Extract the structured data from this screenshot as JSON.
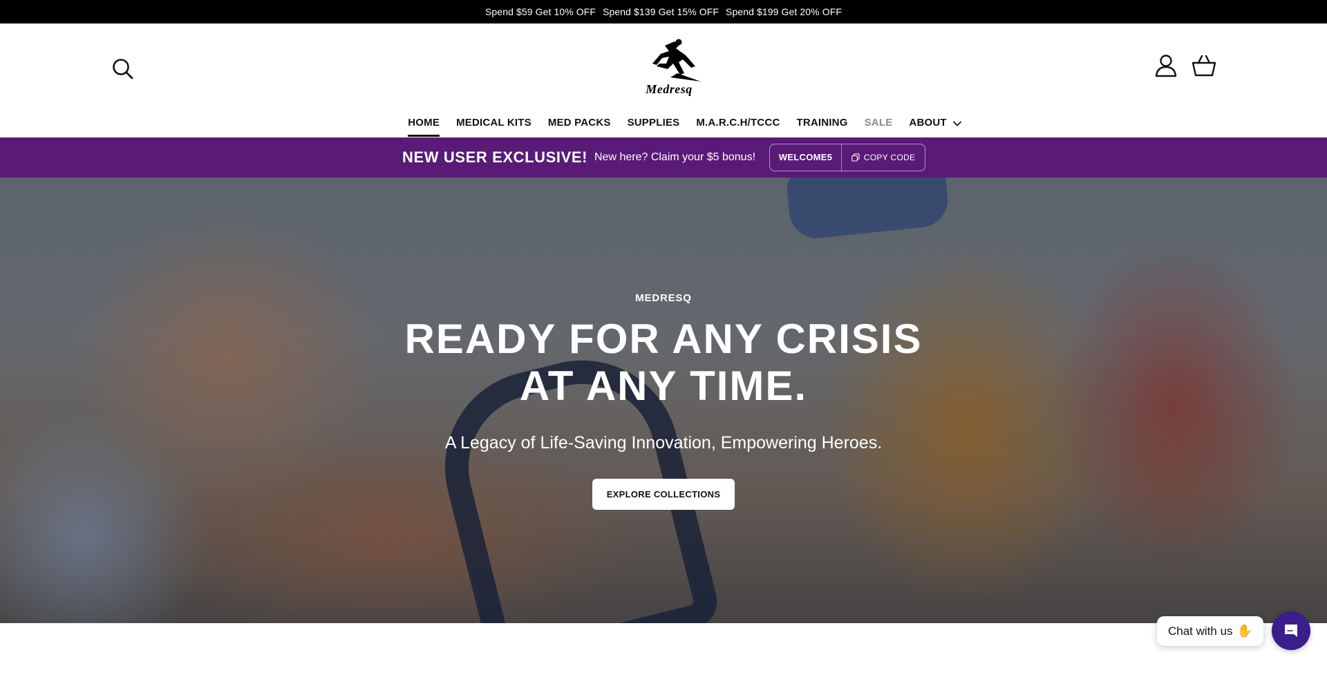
{
  "announcement": {
    "offers": [
      "Spend $59 Get 10% OFF",
      "Spend $139 Get 15% OFF",
      "Spend $199 Get 20% OFF"
    ]
  },
  "header": {
    "logo_text": "Medresq",
    "icons": {
      "search": "search-icon",
      "account": "user-icon",
      "cart": "basket-icon"
    }
  },
  "nav": {
    "items": [
      {
        "label": "HOME",
        "active": true
      },
      {
        "label": "MEDICAL KITS"
      },
      {
        "label": "MED PACKS"
      },
      {
        "label": "SUPPLIES"
      },
      {
        "label": "M.A.R.C.H/TCCC"
      },
      {
        "label": "TRAINING"
      },
      {
        "label": "SALE"
      },
      {
        "label": "ABOUT",
        "has_dropdown": true
      }
    ]
  },
  "promo": {
    "title": "NEW USER EXCLUSIVE!",
    "subtitle": "New here? Claim your $5 bonus!",
    "code": "WELCOME5",
    "copy_label": "COPY CODE",
    "background": "#5a1a78"
  },
  "hero": {
    "eyebrow": "MEDRESQ",
    "title": "READY FOR ANY CRISIS AT ANY TIME.",
    "subtitle": "A Legacy of Life-Saving Innovation, Empowering Heroes.",
    "cta_label": "EXPLORE COLLECTIONS"
  },
  "chat": {
    "bubble_label": "Chat with us",
    "accent": "#3b1e8c"
  }
}
